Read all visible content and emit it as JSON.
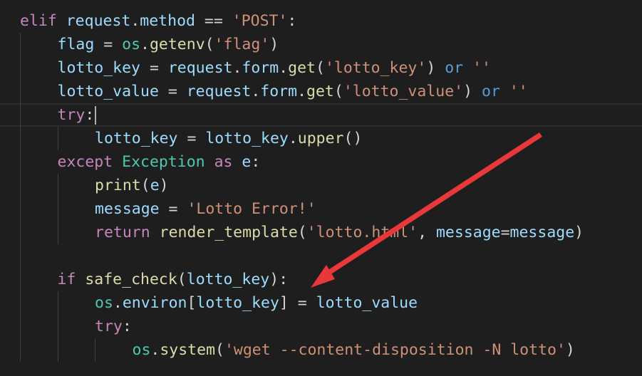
{
  "code_lines": [
    [
      {
        "t": "elif",
        "c": "kw-ctrl"
      },
      {
        "t": " ",
        "c": "op"
      },
      {
        "t": "request",
        "c": "ident"
      },
      {
        "t": ".",
        "c": "op"
      },
      {
        "t": "method",
        "c": "ident"
      },
      {
        "t": " == ",
        "c": "op"
      },
      {
        "t": "'POST'",
        "c": "str"
      },
      {
        "t": ":",
        "c": "op"
      }
    ],
    [
      {
        "t": "flag",
        "c": "ident"
      },
      {
        "t": " = ",
        "c": "op"
      },
      {
        "t": "os",
        "c": "cls"
      },
      {
        "t": ".",
        "c": "op"
      },
      {
        "t": "getenv",
        "c": "fn"
      },
      {
        "t": "(",
        "c": "op"
      },
      {
        "t": "'flag'",
        "c": "str"
      },
      {
        "t": ")",
        "c": "op"
      }
    ],
    [
      {
        "t": "lotto_key",
        "c": "ident"
      },
      {
        "t": " = ",
        "c": "op"
      },
      {
        "t": "request",
        "c": "ident"
      },
      {
        "t": ".",
        "c": "op"
      },
      {
        "t": "form",
        "c": "ident"
      },
      {
        "t": ".",
        "c": "op"
      },
      {
        "t": "get",
        "c": "fn"
      },
      {
        "t": "(",
        "c": "op"
      },
      {
        "t": "'lotto_key'",
        "c": "str"
      },
      {
        "t": ") ",
        "c": "op"
      },
      {
        "t": "or",
        "c": "kw"
      },
      {
        "t": " ",
        "c": "op"
      },
      {
        "t": "''",
        "c": "str"
      }
    ],
    [
      {
        "t": "lotto_value",
        "c": "ident"
      },
      {
        "t": " = ",
        "c": "op"
      },
      {
        "t": "request",
        "c": "ident"
      },
      {
        "t": ".",
        "c": "op"
      },
      {
        "t": "form",
        "c": "ident"
      },
      {
        "t": ".",
        "c": "op"
      },
      {
        "t": "get",
        "c": "fn"
      },
      {
        "t": "(",
        "c": "op"
      },
      {
        "t": "'lotto_value'",
        "c": "str"
      },
      {
        "t": ") ",
        "c": "op"
      },
      {
        "t": "or",
        "c": "kw"
      },
      {
        "t": " ",
        "c": "op"
      },
      {
        "t": "''",
        "c": "str"
      }
    ],
    [
      {
        "t": "try",
        "c": "kw-ctrl"
      },
      {
        "t": ":",
        "c": "op"
      }
    ],
    [
      {
        "t": "lotto_key",
        "c": "ident"
      },
      {
        "t": " = ",
        "c": "op"
      },
      {
        "t": "lotto_key",
        "c": "ident"
      },
      {
        "t": ".",
        "c": "op"
      },
      {
        "t": "upper",
        "c": "fn"
      },
      {
        "t": "()",
        "c": "op"
      }
    ],
    [
      {
        "t": "except",
        "c": "kw-ctrl"
      },
      {
        "t": " ",
        "c": "op"
      },
      {
        "t": "Exception",
        "c": "cls"
      },
      {
        "t": " ",
        "c": "op"
      },
      {
        "t": "as",
        "c": "kw-ctrl"
      },
      {
        "t": " ",
        "c": "op"
      },
      {
        "t": "e",
        "c": "ident"
      },
      {
        "t": ":",
        "c": "op"
      }
    ],
    [
      {
        "t": "print",
        "c": "fn"
      },
      {
        "t": "(",
        "c": "op"
      },
      {
        "t": "e",
        "c": "ident"
      },
      {
        "t": ")",
        "c": "op"
      }
    ],
    [
      {
        "t": "message",
        "c": "ident"
      },
      {
        "t": " = ",
        "c": "op"
      },
      {
        "t": "'Lotto Error!'",
        "c": "str"
      }
    ],
    [
      {
        "t": "return",
        "c": "kw-ctrl"
      },
      {
        "t": " ",
        "c": "op"
      },
      {
        "t": "render_template",
        "c": "fn"
      },
      {
        "t": "(",
        "c": "op"
      },
      {
        "t": "'lotto.html'",
        "c": "str"
      },
      {
        "t": ", ",
        "c": "op"
      },
      {
        "t": "message",
        "c": "ident"
      },
      {
        "t": "=",
        "c": "op"
      },
      {
        "t": "message",
        "c": "ident"
      },
      {
        "t": ")",
        "c": "op"
      }
    ],
    [],
    [
      {
        "t": "if",
        "c": "kw-ctrl"
      },
      {
        "t": " ",
        "c": "op"
      },
      {
        "t": "safe_check",
        "c": "fn"
      },
      {
        "t": "(",
        "c": "op"
      },
      {
        "t": "lotto_key",
        "c": "ident"
      },
      {
        "t": "):",
        "c": "op"
      }
    ],
    [
      {
        "t": "os",
        "c": "cls"
      },
      {
        "t": ".",
        "c": "op"
      },
      {
        "t": "environ",
        "c": "ident"
      },
      {
        "t": "[",
        "c": "op"
      },
      {
        "t": "lotto_key",
        "c": "ident"
      },
      {
        "t": "] = ",
        "c": "op"
      },
      {
        "t": "lotto_value",
        "c": "ident"
      }
    ],
    [
      {
        "t": "try",
        "c": "kw-ctrl"
      },
      {
        "t": ":",
        "c": "op"
      }
    ],
    [
      {
        "t": "os",
        "c": "cls"
      },
      {
        "t": ".",
        "c": "op"
      },
      {
        "t": "system",
        "c": "fn"
      },
      {
        "t": "(",
        "c": "op"
      },
      {
        "t": "'wget --content-disposition -N lotto'",
        "c": "str"
      },
      {
        "t": ")",
        "c": "op"
      }
    ]
  ],
  "indents": [
    0,
    1,
    1,
    1,
    1,
    2,
    1,
    2,
    2,
    2,
    0,
    1,
    2,
    2,
    3
  ],
  "current_line": 4,
  "colors": {
    "background": "#1e1e1e",
    "arrow": "#e8383a"
  },
  "icons": {
    "arrow": "red-annotation-arrow-icon"
  }
}
